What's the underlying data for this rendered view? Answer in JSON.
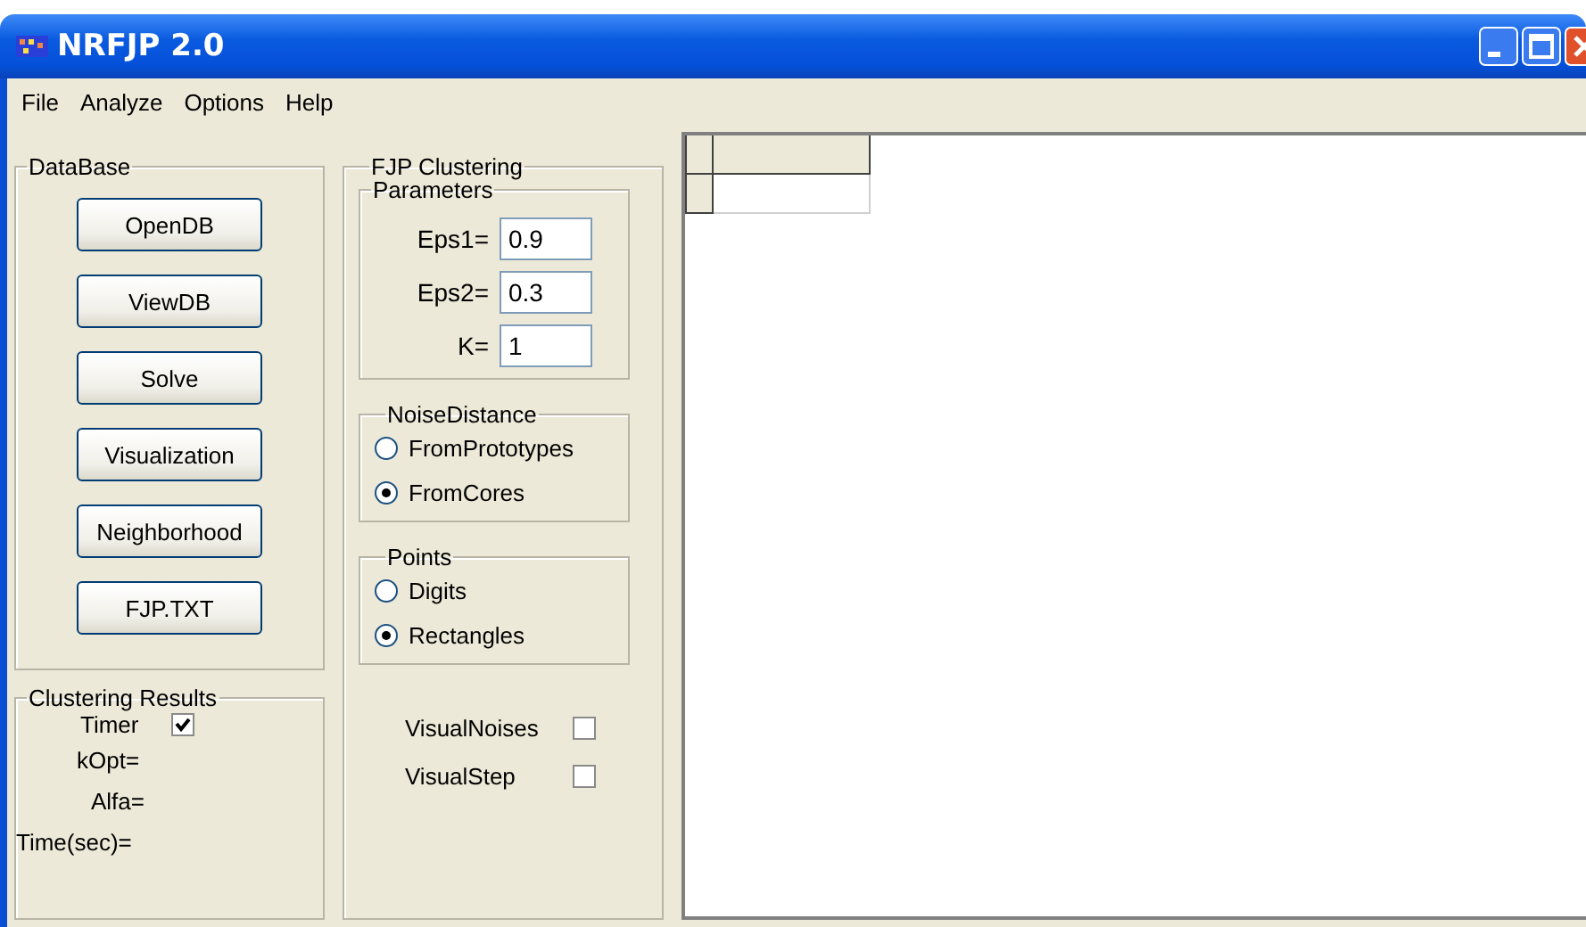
{
  "window": {
    "title": "NRFJP 2.0"
  },
  "menu": [
    "File",
    "Analyze",
    "Options",
    "Help"
  ],
  "database": {
    "title": "DataBase",
    "buttons": [
      "OpenDB",
      "ViewDB",
      "Solve",
      "Visualization",
      "Neighborhood",
      "FJP.TXT"
    ]
  },
  "results": {
    "title": "Clustering Results",
    "timer": {
      "label": "Timer",
      "checked": true
    },
    "fields": [
      "kOpt=",
      "Alfa=",
      "Time(sec)="
    ]
  },
  "clustering": {
    "title": "FJP Clustering",
    "parameters": {
      "title": "Parameters",
      "fields": [
        {
          "label": "Eps1=",
          "value": "0.9"
        },
        {
          "label": "Eps2=",
          "value": "0.3"
        },
        {
          "label": "K=",
          "value": "1"
        }
      ]
    },
    "noise_distance": {
      "title": "NoiseDistance",
      "options": [
        {
          "label": "FromPrototypes",
          "selected": false
        },
        {
          "label": "FromCores",
          "selected": true
        }
      ]
    },
    "points": {
      "title": "Points",
      "options": [
        {
          "label": "Digits",
          "selected": false
        },
        {
          "label": "Rectangles",
          "selected": true
        }
      ]
    },
    "checks": [
      {
        "label": "VisualNoises",
        "checked": false
      },
      {
        "label": "VisualStep",
        "checked": false
      }
    ]
  }
}
